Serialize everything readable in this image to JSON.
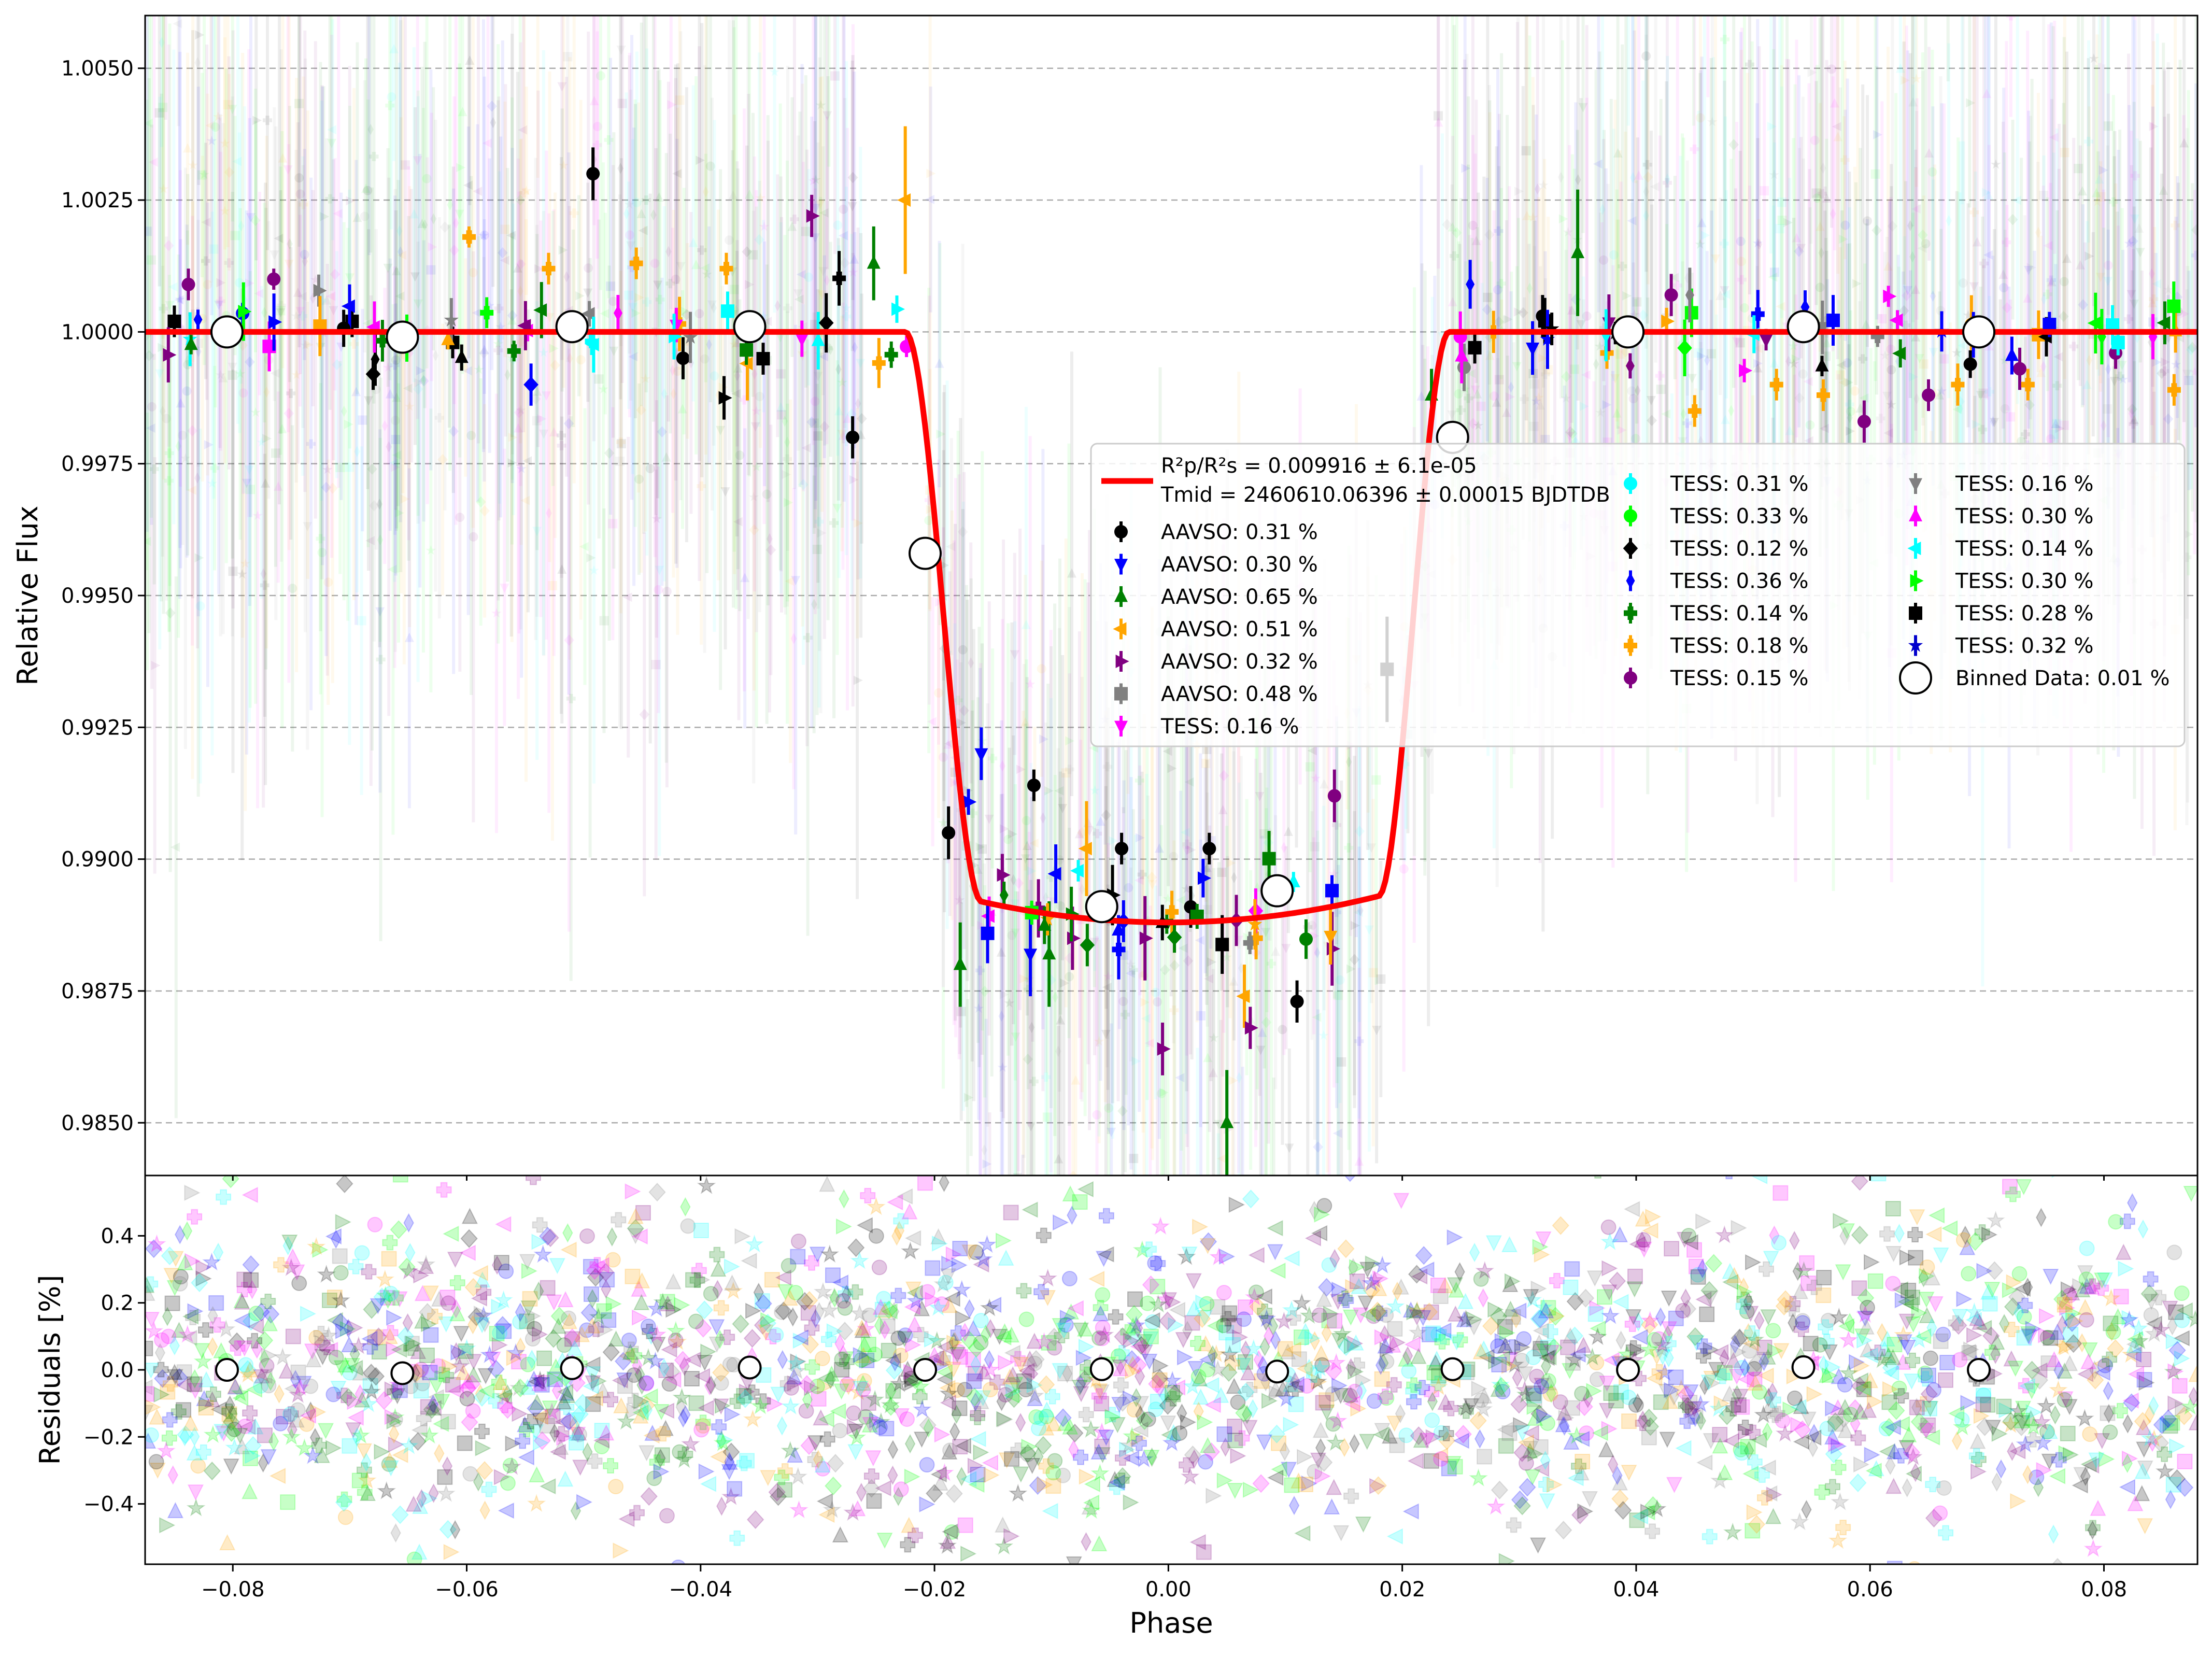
{
  "chart_data": {
    "type": "scatter",
    "top_panel": {
      "ylabel": "Relative Flux",
      "ylim": [
        0.984,
        1.006
      ],
      "yticks": [
        0.985,
        0.9875,
        0.99,
        0.9925,
        0.995,
        0.9975,
        1.0,
        1.0025,
        1.005
      ],
      "ytick_labels": [
        "0.9850",
        "0.9875",
        "0.9900",
        "0.9925",
        "0.9950",
        "0.9975",
        "1.0000",
        "1.0025",
        "1.0050"
      ],
      "grid": "horizontal dashed",
      "model": {
        "color": "#ff0000",
        "transit_depth": 0.0112,
        "ingress_start": -0.0225,
        "ingress_end": -0.016,
        "egress_start": 0.018,
        "egress_end": 0.024,
        "x": [
          -0.088,
          -0.0225,
          -0.02,
          -0.018,
          -0.016,
          -0.01,
          0.0,
          0.01,
          0.016,
          0.018,
          0.02,
          0.022,
          0.0235,
          0.088
        ],
        "y": [
          1.0,
          1.0,
          0.996,
          0.9925,
          0.9908,
          0.9893,
          0.9888,
          0.9893,
          0.9903,
          0.9925,
          0.9958,
          0.999,
          1.0,
          1.0
        ]
      },
      "binned": {
        "x": [
          -0.0805,
          -0.0655,
          -0.051,
          -0.0358,
          -0.0208,
          -0.0057,
          0.0093,
          0.0243,
          0.0393,
          0.0543,
          0.0693
        ],
        "y": [
          1.0,
          0.9999,
          1.0001,
          1.0001,
          0.9958,
          0.9891,
          0.9894,
          0.998,
          1.0,
          1.0001,
          1.0
        ]
      },
      "highlighted_points": [
        {
          "x": -0.085,
          "y": 1.0002,
          "err": 0.0003,
          "color": "#000000",
          "marker": "square"
        },
        {
          "x": -0.0838,
          "y": 1.0009,
          "err": 0.0003,
          "color": "#800080",
          "marker": "circle"
        },
        {
          "x": -0.0765,
          "y": 1.001,
          "err": 0.0002,
          "color": "#800080",
          "marker": "circle"
        },
        {
          "x": -0.0698,
          "y": 1.0002,
          "err": 0.0003,
          "color": "#000000",
          "marker": "square"
        },
        {
          "x": -0.068,
          "y": 0.9992,
          "err": 0.0003,
          "color": "#000000",
          "marker": "diamond"
        },
        {
          "x": -0.0612,
          "y": 0.9998,
          "err": 0.0003,
          "color": "#000000",
          "marker": "square"
        },
        {
          "x": -0.0598,
          "y": 1.0018,
          "err": 0.0002,
          "color": "#ffa500",
          "marker": "plus"
        },
        {
          "x": -0.0545,
          "y": 0.999,
          "err": 0.0004,
          "color": "#0000ff",
          "marker": "diamond"
        },
        {
          "x": -0.053,
          "y": 1.0012,
          "err": 0.0003,
          "color": "#ffa500",
          "marker": "plus"
        },
        {
          "x": -0.0492,
          "y": 1.003,
          "err": 0.0005,
          "color": "#000000",
          "marker": "circle"
        },
        {
          "x": -0.0455,
          "y": 1.0013,
          "err": 0.0003,
          "color": "#ffa500",
          "marker": "plus"
        },
        {
          "x": -0.0415,
          "y": 0.9995,
          "err": 0.0004,
          "color": "#000000",
          "marker": "circle"
        },
        {
          "x": -0.0378,
          "y": 1.0012,
          "err": 0.0003,
          "color": "#ffa500",
          "marker": "plus"
        },
        {
          "x": -0.036,
          "y": 0.9994,
          "err": 0.0007,
          "color": "#ffa500",
          "marker": "tri_left"
        },
        {
          "x": -0.0305,
          "y": 1.0022,
          "err": 0.0004,
          "color": "#800080",
          "marker": "tri_right"
        },
        {
          "x": -0.027,
          "y": 0.998,
          "err": 0.0004,
          "color": "#000000",
          "marker": "circle"
        },
        {
          "x": -0.0252,
          "y": 1.0013,
          "err": 0.0007,
          "color": "#008000",
          "marker": "tri_up"
        },
        {
          "x": -0.0225,
          "y": 1.0025,
          "err": 0.0014,
          "color": "#ffa500",
          "marker": "tri_left"
        },
        {
          "x": -0.021,
          "y": 0.996,
          "err": 0.0004,
          "color": "#ffffff",
          "marker": "none"
        },
        {
          "x": -0.0188,
          "y": 0.9905,
          "err": 0.0005,
          "color": "#000000",
          "marker": "circle"
        },
        {
          "x": -0.0178,
          "y": 0.988,
          "err": 0.0008,
          "color": "#008000",
          "marker": "tri_up"
        },
        {
          "x": -0.016,
          "y": 0.992,
          "err": 0.0005,
          "color": "#0000ff",
          "marker": "tri_down"
        },
        {
          "x": -0.0142,
          "y": 0.9897,
          "err": 0.0004,
          "color": "#800080",
          "marker": "tri_right"
        },
        {
          "x": -0.0118,
          "y": 0.9882,
          "err": 0.0008,
          "color": "#0000ff",
          "marker": "tri_down"
        },
        {
          "x": -0.0115,
          "y": 0.9914,
          "err": 0.0003,
          "color": "#000000",
          "marker": "circle"
        },
        {
          "x": -0.0102,
          "y": 0.9882,
          "err": 0.001,
          "color": "#008000",
          "marker": "tri_up"
        },
        {
          "x": -0.0082,
          "y": 0.9885,
          "err": 0.0006,
          "color": "#800080",
          "marker": "tri_right"
        },
        {
          "x": -0.007,
          "y": 0.9902,
          "err": 0.0009,
          "color": "#ffa500",
          "marker": "tri_left"
        },
        {
          "x": -0.004,
          "y": 0.9902,
          "err": 0.0003,
          "color": "#000000",
          "marker": "circle"
        },
        {
          "x": -0.002,
          "y": 0.9885,
          "err": 0.0008,
          "color": "#800080",
          "marker": "tri_right"
        },
        {
          "x": -0.0005,
          "y": 0.9864,
          "err": 0.0005,
          "color": "#800080",
          "marker": "tri_right"
        },
        {
          "x": 0.0003,
          "y": 0.989,
          "err": 0.0004,
          "color": "#ffa500",
          "marker": "plus"
        },
        {
          "x": 0.0035,
          "y": 0.9902,
          "err": 0.0003,
          "color": "#000000",
          "marker": "circle"
        },
        {
          "x": 0.005,
          "y": 0.985,
          "err": 0.001,
          "color": "#008000",
          "marker": "tri_up"
        },
        {
          "x": 0.0065,
          "y": 0.9874,
          "err": 0.0006,
          "color": "#ffa500",
          "marker": "tri_left"
        },
        {
          "x": 0.007,
          "y": 0.9868,
          "err": 0.0004,
          "color": "#800080",
          "marker": "tri_right"
        },
        {
          "x": 0.0075,
          "y": 0.9885,
          "err": 0.0004,
          "color": "#ffa500",
          "marker": "plus"
        },
        {
          "x": 0.011,
          "y": 0.9873,
          "err": 0.0004,
          "color": "#000000",
          "marker": "circle"
        },
        {
          "x": 0.014,
          "y": 0.9883,
          "err": 0.0007,
          "color": "#800080",
          "marker": "tri_right"
        },
        {
          "x": 0.0142,
          "y": 0.9912,
          "err": 0.0005,
          "color": "#800080",
          "marker": "circle"
        },
        {
          "x": 0.0187,
          "y": 0.9936,
          "err": 0.001,
          "color": "#000000",
          "marker": "square"
        },
        {
          "x": 0.0225,
          "y": 0.9988,
          "err": 0.0005,
          "color": "#008000",
          "marker": "tri_up"
        },
        {
          "x": 0.0262,
          "y": 0.9997,
          "err": 0.0003,
          "color": "#000000",
          "marker": "square"
        },
        {
          "x": 0.0278,
          "y": 1.0,
          "err": 0.0004,
          "color": "#ffa500",
          "marker": "plus"
        },
        {
          "x": 0.032,
          "y": 1.0003,
          "err": 0.0004,
          "color": "#000000",
          "marker": "circle"
        },
        {
          "x": 0.035,
          "y": 1.0015,
          "err": 0.0012,
          "color": "#008000",
          "marker": "tri_up"
        },
        {
          "x": 0.0375,
          "y": 0.9996,
          "err": 0.0003,
          "color": "#ffa500",
          "marker": "plus"
        },
        {
          "x": 0.043,
          "y": 1.0007,
          "err": 0.0004,
          "color": "#800080",
          "marker": "circle"
        },
        {
          "x": 0.045,
          "y": 0.9985,
          "err": 0.0003,
          "color": "#ffa500",
          "marker": "plus"
        },
        {
          "x": 0.052,
          "y": 0.999,
          "err": 0.0003,
          "color": "#ffa500",
          "marker": "plus"
        },
        {
          "x": 0.056,
          "y": 0.9988,
          "err": 0.0003,
          "color": "#ffa500",
          "marker": "plus"
        },
        {
          "x": 0.0595,
          "y": 0.9983,
          "err": 0.0004,
          "color": "#800080",
          "marker": "circle"
        },
        {
          "x": 0.065,
          "y": 0.9988,
          "err": 0.0003,
          "color": "#800080",
          "marker": "circle"
        },
        {
          "x": 0.0675,
          "y": 0.999,
          "err": 0.0004,
          "color": "#ffa500",
          "marker": "plus"
        },
        {
          "x": 0.0728,
          "y": 0.9993,
          "err": 0.0004,
          "color": "#800080",
          "marker": "circle"
        },
        {
          "x": 0.0735,
          "y": 0.999,
          "err": 0.0003,
          "color": "#ffa500",
          "marker": "plus"
        },
        {
          "x": 0.081,
          "y": 0.9996,
          "err": 0.0003,
          "color": "#800080",
          "marker": "circle"
        },
        {
          "x": 0.086,
          "y": 0.9989,
          "err": 0.0003,
          "color": "#ffa500",
          "marker": "plus"
        }
      ]
    },
    "bottom_panel": {
      "ylabel": "Residuals [%]",
      "ylim": [
        -0.58,
        0.58
      ],
      "yticks": [
        -0.4,
        -0.2,
        0.0,
        0.2,
        0.4
      ],
      "ytick_labels": [
        "−0.4",
        "−0.2",
        "0.0",
        "0.2",
        "0.4"
      ],
      "binned_residuals": {
        "x": [
          -0.0805,
          -0.0655,
          -0.051,
          -0.0358,
          -0.0208,
          -0.0057,
          0.0093,
          0.0243,
          0.0393,
          0.0543,
          0.0693
        ],
        "y": [
          0.0,
          -0.01,
          0.005,
          0.007,
          0.0,
          0.002,
          -0.005,
          0.002,
          0.0,
          0.008,
          0.0
        ]
      }
    },
    "xlabel": "Phase",
    "xlim": [
      -0.0875,
      0.088
    ],
    "xticks": [
      -0.08,
      -0.06,
      -0.04,
      -0.02,
      0.0,
      0.02,
      0.04,
      0.06,
      0.08
    ],
    "xtick_labels": [
      "−0.08",
      "−0.06",
      "−0.04",
      "−0.02",
      "0.00",
      "0.02",
      "0.04",
      "0.06",
      "0.08"
    ],
    "scatter_colors": [
      "#000000",
      "#0000ff",
      "#008000",
      "#ffa500",
      "#800080",
      "#808080",
      "#ff00ff",
      "#00ffff",
      "#00ff00"
    ],
    "legend": {
      "placement": "center-right",
      "model_line1": "R²p/R²s = 0.009916 ± 6.1e-05",
      "model_line2": "Tmid = 2460610.06396 ± 0.00015 BJDTDB",
      "entries": [
        {
          "label": "AAVSO: 0.31 %",
          "color": "#000000",
          "marker": "circle"
        },
        {
          "label": "AAVSO: 0.30 %",
          "color": "#0000ff",
          "marker": "tri_down"
        },
        {
          "label": "AAVSO: 0.65 %",
          "color": "#008000",
          "marker": "tri_up"
        },
        {
          "label": "AAVSO: 0.51 %",
          "color": "#ffa500",
          "marker": "tri_left"
        },
        {
          "label": "AAVSO: 0.32 %",
          "color": "#800080",
          "marker": "tri_right"
        },
        {
          "label": "AAVSO: 0.48 %",
          "color": "#808080",
          "marker": "square"
        },
        {
          "label": "TESS: 0.16 %",
          "color": "#ff00ff",
          "marker": "tri_down"
        },
        {
          "label": "TESS: 0.31 %",
          "color": "#00ffff",
          "marker": "hexagon"
        },
        {
          "label": "TESS: 0.33 %",
          "color": "#00ff00",
          "marker": "hexagon"
        },
        {
          "label": "TESS: 0.12 %",
          "color": "#000000",
          "marker": "diamond"
        },
        {
          "label": "TESS: 0.36 %",
          "color": "#0000ff",
          "marker": "thin_diamond"
        },
        {
          "label": "TESS: 0.14 %",
          "color": "#008000",
          "marker": "plus"
        },
        {
          "label": "TESS: 0.18 %",
          "color": "#ffa500",
          "marker": "plus"
        },
        {
          "label": "TESS: 0.15 %",
          "color": "#800080",
          "marker": "circle"
        },
        {
          "label": "TESS: 0.16 %",
          "color": "#808080",
          "marker": "tri_down"
        },
        {
          "label": "TESS: 0.30 %",
          "color": "#ff00ff",
          "marker": "tri_up"
        },
        {
          "label": "TESS: 0.14 %",
          "color": "#00ffff",
          "marker": "tri_left"
        },
        {
          "label": "TESS: 0.30 %",
          "color": "#00ff00",
          "marker": "tri_right"
        },
        {
          "label": "TESS: 0.28 %",
          "color": "#000000",
          "marker": "square"
        },
        {
          "label": "TESS: 0.32 %",
          "color": "#0000cc",
          "marker": "star"
        },
        {
          "label": "Binned Data: 0.01 %",
          "color": "#ffffff",
          "marker": "big_circle"
        }
      ]
    }
  }
}
